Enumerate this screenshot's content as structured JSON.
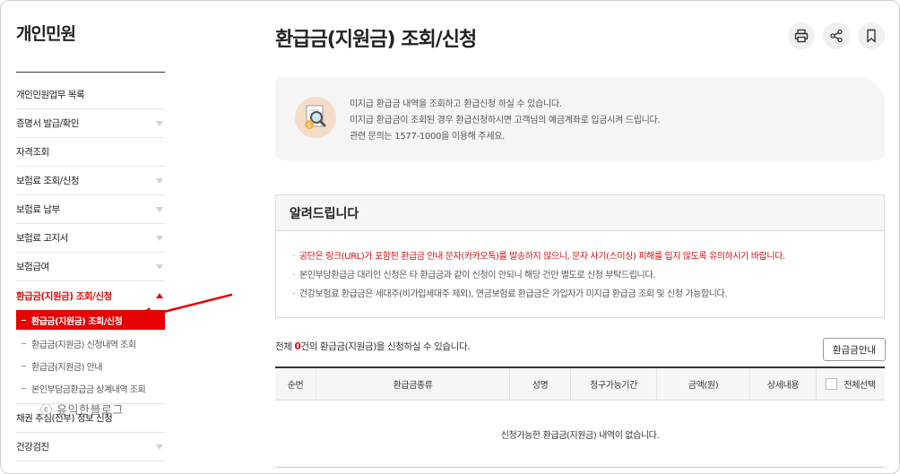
{
  "sidebar": {
    "title": "개인민원",
    "items": [
      {
        "label": "개인민원업무 목록",
        "chevron": false
      },
      {
        "label": "증명서 발급/확인",
        "chevron": true
      },
      {
        "label": "자격조회",
        "chevron": false
      },
      {
        "label": "보험료 조회/신청",
        "chevron": true
      },
      {
        "label": "보험료 납부",
        "chevron": true
      },
      {
        "label": "보험료 고지서",
        "chevron": true
      },
      {
        "label": "보험급여",
        "chevron": true
      },
      {
        "label": "환급금(지원금) 조회/신청",
        "chevron": true,
        "expanded": true
      }
    ],
    "sub_items": [
      {
        "label": "환급금(지원금) 조회/신청",
        "current": true
      },
      {
        "label": "환급금(지원금) 신청내역 조회",
        "current": false
      },
      {
        "label": "환급금(지원금) 안내",
        "current": false
      },
      {
        "label": "본인부담금환급금 상계내역 조회",
        "current": false
      }
    ],
    "items_after": [
      {
        "label": "채권 추심(전부) 정보 신청",
        "chevron": false
      },
      {
        "label": "건강검진",
        "chevron": true
      }
    ]
  },
  "watermark": "ⓒ 유익한블로그",
  "main": {
    "title": "환급금(지원금) 조회/신청",
    "tools": [
      {
        "icon": "print-icon",
        "label": "인쇄"
      },
      {
        "icon": "share-icon",
        "label": "공유"
      },
      {
        "icon": "bookmark-icon",
        "label": "북마크"
      }
    ],
    "info_lines": [
      "미지급 환급금 내역을 조회하고 환급신청 하실 수 있습니다.",
      "미지급 환급금이 조회된 경우 환급신청하시면 고객님의 예금계좌로 입금시켜 드립니다.",
      "관련 문의는 1577-1000을 이용해 주세요."
    ],
    "notice": {
      "title": "알려드립니다",
      "items": [
        "공단은 링크(URL)가 포함된 환급금 안내 문자(카카오톡)를 발송하지 않으니, 문자 사기(스미싱) 피해를 입지 않도록 유의하시기 바랍니다.",
        "본인부담환급금 대리인 신청은 타 환급금과 같이 신청이 안되니 해당 건만 별도로 신청 부탁드립니다.",
        "건강보험료 환급금은 세대주(비가입세대주 제외), 연금보험료 환급금은 가입자가 미지급 환급금 조회 및 신청 가능합니다."
      ]
    },
    "summary": {
      "prefix": "전체 ",
      "count": "0",
      "suffix": "건의 환급금(지원금)을 신청하실 수 있습니다."
    },
    "guide_button": "환급금안내",
    "table": {
      "columns": [
        "순번",
        "환급금종류",
        "성명",
        "청구가능기간",
        "금액(원)",
        "상세내용",
        "전체선택"
      ],
      "empty_message": "신청가능한 환급금(지원금) 내역이 없습니다."
    }
  },
  "colors": {
    "accent": "#e60000",
    "warning": "#d90d0d"
  }
}
